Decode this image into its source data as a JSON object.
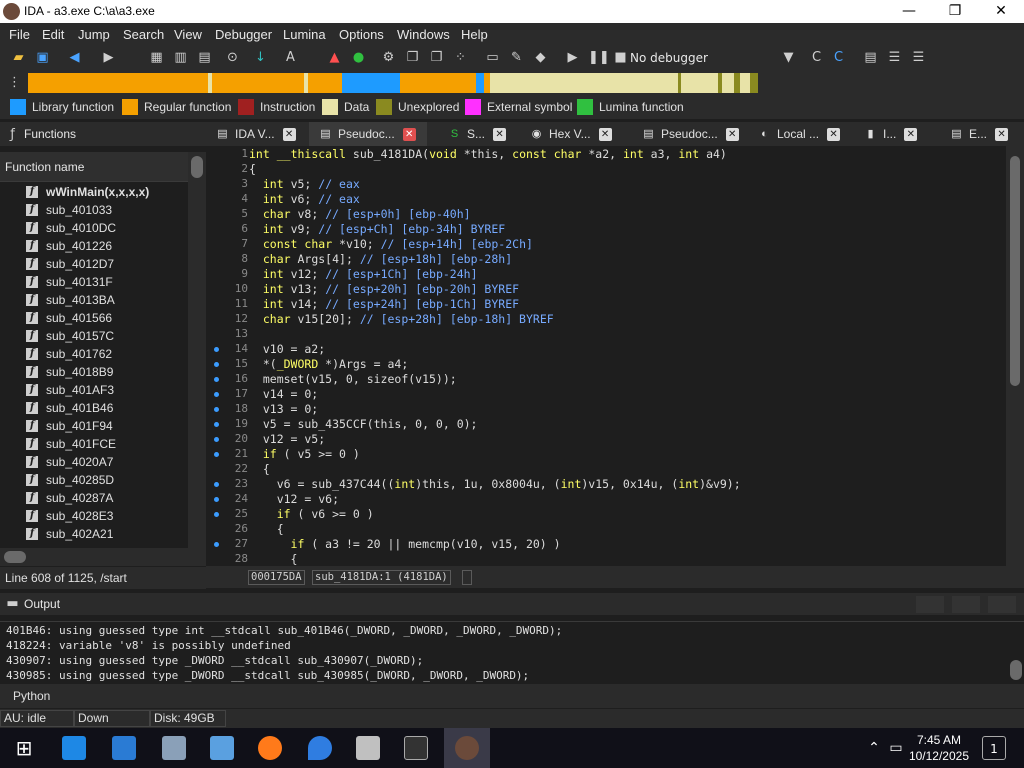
{
  "window": {
    "title": "IDA - a3.exe C:\\a\\a3.exe"
  },
  "menu": [
    "File",
    "Edit",
    "Jump",
    "Search",
    "View",
    "Debugger",
    "Lumina",
    "Options",
    "Windows",
    "Help"
  ],
  "toolbar": {
    "debugger": "No debugger"
  },
  "legend": [
    {
      "label": "Library function",
      "color": "#1e9bff"
    },
    {
      "label": "Regular function",
      "color": "#f5a000"
    },
    {
      "label": "Instruction",
      "color": "#a02020"
    },
    {
      "label": "Data",
      "color": "#e8e3a8"
    },
    {
      "label": "Unexplored",
      "color": "#8a8a20"
    },
    {
      "label": "External symbol",
      "color": "#ff30ff"
    },
    {
      "label": "Lumina function",
      "color": "#30c040"
    }
  ],
  "functions": {
    "title": "Functions",
    "column": "Function name",
    "items": [
      "wWinMain(x,x,x,x)",
      "sub_401033",
      "sub_4010DC",
      "sub_401226",
      "sub_4012D7",
      "sub_40131F",
      "sub_4013BA",
      "sub_401566",
      "sub_40157C",
      "sub_401762",
      "sub_4018B9",
      "sub_401AF3",
      "sub_401B46",
      "sub_401F94",
      "sub_401FCE",
      "sub_4020A7",
      "sub_40285D",
      "sub_40287A",
      "sub_4028E3",
      "sub_402A21"
    ],
    "status": "Line 608 of 1125, /start"
  },
  "tabs": [
    {
      "label": "IDA V...",
      "icon": "▤"
    },
    {
      "label": "Pseudoc...",
      "icon": "▤"
    },
    {
      "label": "S...",
      "icon": "S"
    },
    {
      "label": "Hex V...",
      "icon": "◉"
    },
    {
      "label": "Pseudoc...",
      "icon": "▤"
    },
    {
      "label": "Local ...",
      "icon": "◐"
    },
    {
      "label": "I...",
      "icon": "▮"
    },
    {
      "label": "E...",
      "icon": "▤"
    }
  ],
  "code": {
    "lines": [
      {
        "n": "1",
        "t": "int __thiscall sub_4181DA(void *this, const char *a2, int a3, int a4)",
        "dot": false
      },
      {
        "n": "2",
        "t": "{",
        "dot": false
      },
      {
        "n": "3",
        "t": "  int v5; // eax",
        "dot": false
      },
      {
        "n": "4",
        "t": "  int v6; // eax",
        "dot": false
      },
      {
        "n": "5",
        "t": "  char v8; // [esp+0h] [ebp-40h]",
        "dot": false
      },
      {
        "n": "6",
        "t": "  int v9; // [esp+Ch] [ebp-34h] BYREF",
        "dot": false
      },
      {
        "n": "7",
        "t": "  const char *v10; // [esp+14h] [ebp-2Ch]",
        "dot": false
      },
      {
        "n": "8",
        "t": "  char Args[4]; // [esp+18h] [ebp-28h]",
        "dot": false
      },
      {
        "n": "9",
        "t": "  int v12; // [esp+1Ch] [ebp-24h]",
        "dot": false
      },
      {
        "n": "10",
        "t": "  int v13; // [esp+20h] [ebp-20h] BYREF",
        "dot": false
      },
      {
        "n": "11",
        "t": "  int v14; // [esp+24h] [ebp-1Ch] BYREF",
        "dot": false
      },
      {
        "n": "12",
        "t": "  char v15[20]; // [esp+28h] [ebp-18h] BYREF",
        "dot": false
      },
      {
        "n": "13",
        "t": "",
        "dot": false
      },
      {
        "n": "14",
        "t": "  v10 = a2;",
        "dot": true
      },
      {
        "n": "15",
        "t": "  *(_DWORD *)Args = a4;",
        "dot": true
      },
      {
        "n": "16",
        "t": "  memset(v15, 0, sizeof(v15));",
        "dot": true
      },
      {
        "n": "17",
        "t": "  v14 = 0;",
        "dot": true
      },
      {
        "n": "18",
        "t": "  v13 = 0;",
        "dot": true
      },
      {
        "n": "19",
        "t": "  v5 = sub_435CCF(this, 0, 0, 0);",
        "dot": true
      },
      {
        "n": "20",
        "t": "  v12 = v5;",
        "dot": true
      },
      {
        "n": "21",
        "t": "  if ( v5 >= 0 )",
        "dot": true
      },
      {
        "n": "22",
        "t": "  {",
        "dot": false
      },
      {
        "n": "23",
        "t": "    v6 = sub_437C44((int)this, 1u, 0x8004u, (int)v15, 0x14u, (int)&v9);",
        "dot": true
      },
      {
        "n": "24",
        "t": "    v12 = v6;",
        "dot": true
      },
      {
        "n": "25",
        "t": "    if ( v6 >= 0 )",
        "dot": true
      },
      {
        "n": "26",
        "t": "    {",
        "dot": false
      },
      {
        "n": "27",
        "t": "      if ( a3 != 20 || memcmp(v10, v15, 20) )",
        "dot": true
      },
      {
        "n": "28",
        "t": "      {",
        "dot": false
      }
    ],
    "addr": "000175DA",
    "loc": "sub_4181DA:1 (4181DA)"
  },
  "output": {
    "title": "Output",
    "lines": [
      "401B46: using guessed type int __stdcall sub_401B46(_DWORD, _DWORD, _DWORD, _DWORD);",
      "418224: variable 'v8' is possibly undefined",
      "430907: using guessed type _DWORD __stdcall sub_430907(_DWORD);",
      "430985: using guessed type _DWORD __stdcall sub_430985(_DWORD, _DWORD, _DWORD);"
    ]
  },
  "python": "Python",
  "status": {
    "au": "AU:",
    "state": "idle",
    "dir": "Down",
    "disk": "Disk: 49GB"
  },
  "taskbar": {
    "time": "7:45 AM",
    "date": "10/12/2025",
    "notif": "1"
  }
}
